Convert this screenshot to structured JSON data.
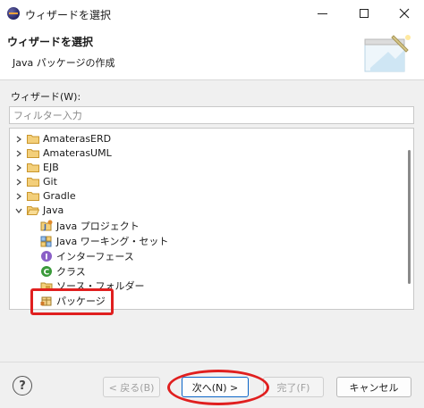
{
  "window": {
    "title": "ウィザードを選択"
  },
  "header": {
    "title": "ウィザードを選択",
    "description": "Java パッケージの作成"
  },
  "wizard_label": "ウィザード(W):",
  "filter": {
    "placeholder": "フィルター入力",
    "value": ""
  },
  "tree": {
    "folders": [
      {
        "label": "AmaterasERD",
        "expanded": false
      },
      {
        "label": "AmaterasUML",
        "expanded": false
      },
      {
        "label": "EJB",
        "expanded": false
      },
      {
        "label": "Git",
        "expanded": false
      },
      {
        "label": "Gradle",
        "expanded": false
      },
      {
        "label": "Java",
        "expanded": true
      }
    ],
    "java_children": [
      {
        "label": "Java プロジェクト",
        "icon": "java-project-icon"
      },
      {
        "label": "Java ワーキング・セット",
        "icon": "working-set-icon"
      },
      {
        "label": "インターフェース",
        "icon": "interface-icon"
      },
      {
        "label": "クラス",
        "icon": "class-icon"
      },
      {
        "label": "ソース・フォルダー",
        "icon": "source-folder-icon"
      },
      {
        "label": "パッケージ",
        "icon": "package-icon",
        "selected": true
      }
    ]
  },
  "buttons": {
    "help": "?",
    "back": "< 戻る(B)",
    "next": "次へ(N) >",
    "finish": "完了(F)",
    "cancel": "キャンセル"
  },
  "colors": {
    "annotation": "#e01f1f",
    "default_button_border": "#0a64c8",
    "folder": "#e8b95a"
  }
}
